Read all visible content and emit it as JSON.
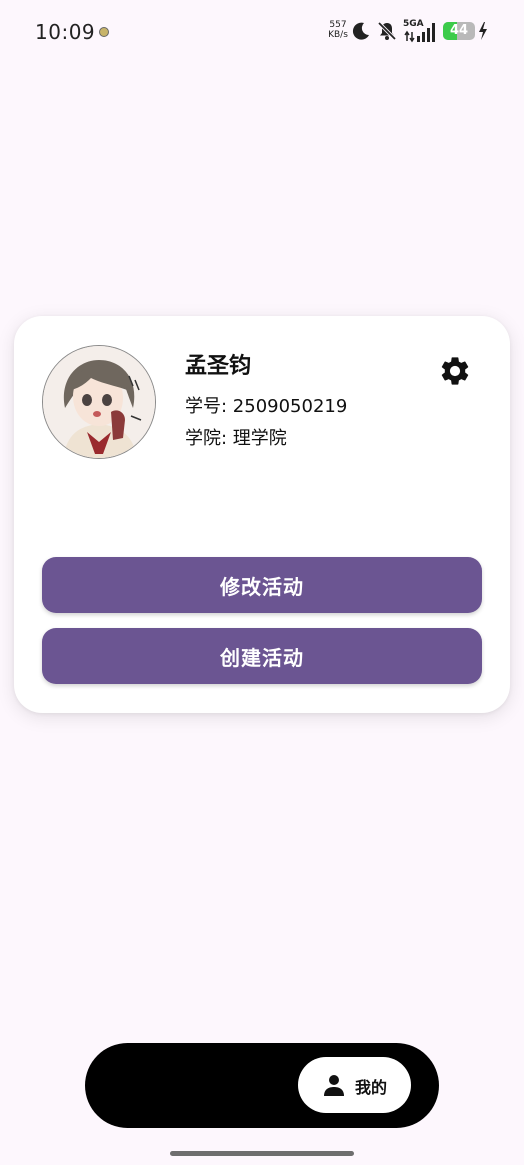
{
  "status_bar": {
    "time": "10:09",
    "net_speed_value": "557",
    "net_speed_unit": "KB/s",
    "network_type": "5GA",
    "battery_level": "44",
    "battery_fraction": 0.44,
    "icons": [
      "notification-dot-icon",
      "moon-icon",
      "mute-icon",
      "signal-icon",
      "battery-icon",
      "charging-icon"
    ]
  },
  "profile": {
    "name": "孟圣钧",
    "student_id": "学号: 2509050219",
    "college": "学院: 理学院",
    "avatar_icon": "avatar-illustration",
    "settings_icon": "gear-icon"
  },
  "actions": {
    "edit_label": "修改活动",
    "create_label": "创建活动"
  },
  "bottom_nav": {
    "mine_label": "我的",
    "mine_icon": "person-icon"
  },
  "colors": {
    "background": "#fdf7fd",
    "button": "#6b5592",
    "nav_bar": "#000000",
    "battery_green": "#3ccb4a"
  }
}
